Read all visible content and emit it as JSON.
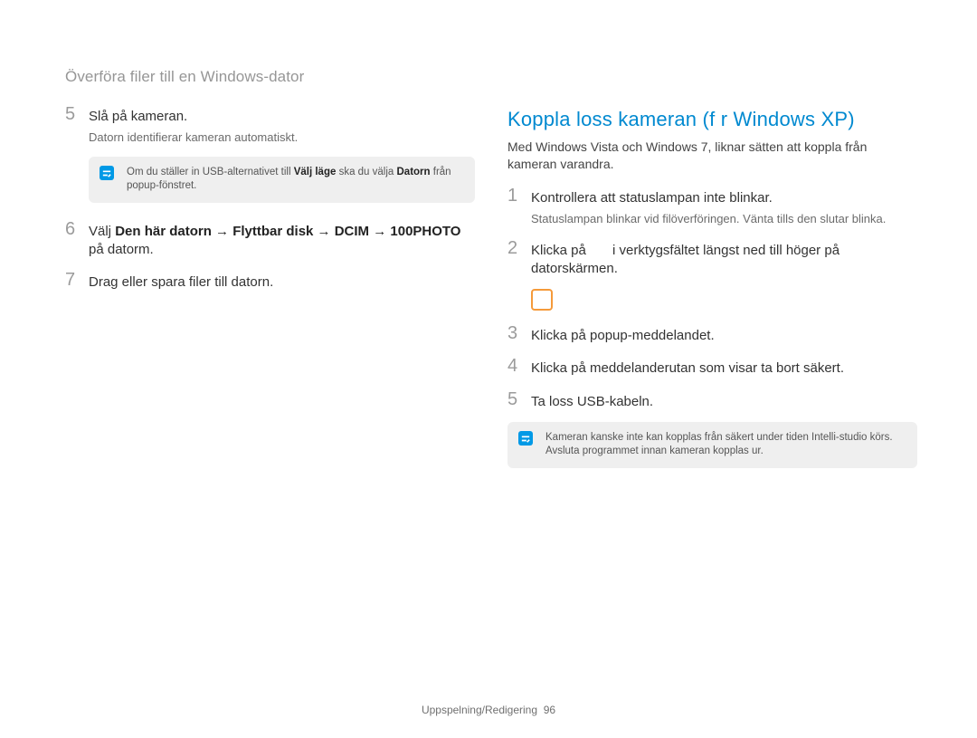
{
  "title": "Överföra filer till en Windows-dator",
  "left": {
    "step5": {
      "num": "5",
      "main": "Slå på kameran.",
      "sub": "Datorn identifierar kameran automatiskt."
    },
    "note5_pre": "Om du ställer in USB-alternativet till ",
    "note5_b1": "Välj läge",
    "note5_mid": " ska du välja ",
    "note5_b2": "Datorn",
    "note5_post": " från popup-fönstret.",
    "step6": {
      "num": "6",
      "main_pre": "Välj ",
      "main_b": "Den här datorn → Flyttbar disk → DCIM → 100PHOTO",
      "main_post": " på datorm."
    },
    "step7": {
      "num": "7",
      "main": "Drag eller spara filer till datorn."
    }
  },
  "right": {
    "heading": "Koppla loss kameran (f r Windows XP)",
    "intro": "Med Windows Vista och Windows 7, liknar sätten att koppla från kameran varandra.",
    "step1": {
      "num": "1",
      "main": "Kontrollera att statuslampan inte blinkar.",
      "sub": "Statuslampan blinkar vid filöverföringen. Vänta tills den slutar blinka."
    },
    "step2": {
      "num": "2",
      "main_pre": "Klicka på ",
      "main_post": " i verktygsfältet längst ned till höger på datorskärmen."
    },
    "step3": {
      "num": "3",
      "main": "Klicka på popup-meddelandet."
    },
    "step4": {
      "num": "4",
      "main": "Klicka på meddelanderutan som visar ta bort säkert."
    },
    "step5": {
      "num": "5",
      "main": "Ta loss USB-kabeln."
    },
    "noteB": "Kameran kanske inte kan kopplas från säkert under tiden Intelli-studio körs. Avsluta programmet innan kameran kopplas ur."
  },
  "footer_section": "Uppspelning/Redigering",
  "footer_page": "96"
}
